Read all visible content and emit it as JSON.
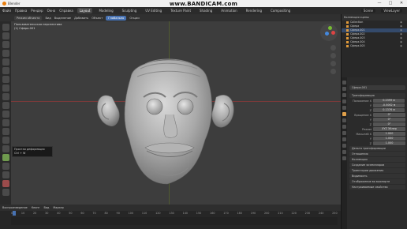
{
  "window": {
    "title": "Blender",
    "controls": [
      "—",
      "□",
      "✕"
    ]
  },
  "watermark": "www.BANDICAM.com",
  "menu": {
    "items": [
      "Файл",
      "Правка",
      "Рендер",
      "Окно",
      "Справка"
    ],
    "workspaces": [
      "Layout",
      "Modeling",
      "Sculpting",
      "UV Editing",
      "Texture Paint",
      "Shading",
      "Animation",
      "Rendering",
      "Compositing"
    ],
    "scene": "Scene",
    "view_layer": "ViewLayer"
  },
  "viewport_header": {
    "mode": "Режим объекта",
    "menus": [
      "Вид",
      "Выделение",
      "Добавить",
      "Объект"
    ],
    "transform": "Глобально",
    "items": [
      "Опции"
    ]
  },
  "viewport": {
    "info_line1": "Пользовательская перспектива",
    "info_line2": "(1) Сферa.001",
    "colors": {
      "bg": "#3d3d3d",
      "x_axis": "#7a3a3a",
      "y_axis": "#5e6e2a"
    }
  },
  "tooltip": {
    "line1": "Простая деформация",
    "line2": "Ctrl + W"
  },
  "timeline": {
    "menus": [
      "Воспроизведение",
      "Кеинг",
      "Вид",
      "Маркер"
    ],
    "frames": [
      "0",
      "10",
      "20",
      "30",
      "40",
      "50",
      "60",
      "70",
      "80",
      "90",
      "100",
      "110",
      "120",
      "130",
      "140",
      "150",
      "160",
      "170",
      "180",
      "190",
      "200",
      "210",
      "220",
      "230",
      "240",
      "250"
    ]
  },
  "outliner": {
    "title": "Коллекция сцены",
    "rows": [
      "Collection",
      "Сфера",
      "Сфера.001",
      "Сфера.002",
      "Сфера.003",
      "Сфера.004",
      "Сфера.005"
    ]
  },
  "properties": {
    "object_name": "Сфера.001",
    "sections": {
      "transform": "Трансформация",
      "delta": "Дельта трансформации",
      "relations": "Отношения",
      "collections": "Коллекции",
      "instancing": "Создание экземпляров",
      "motion": "Траектории движения",
      "visibility": "Видимость",
      "viewport_display": "Отображение во вьюпорте",
      "custom": "Настраиваемые свойства"
    },
    "location_label": "Положение X",
    "location": [
      "0.2399 м",
      "-0.5062 м",
      "0.1376 м"
    ],
    "rotation_label": "Вращение X",
    "rotation": [
      "0°",
      "0°",
      "0°"
    ],
    "mode_label": "Режим",
    "mode_value": "XYZ Эйлер",
    "scale_label": "Масштаб X",
    "scale": [
      "1.000",
      "1.000",
      "1.000"
    ]
  }
}
